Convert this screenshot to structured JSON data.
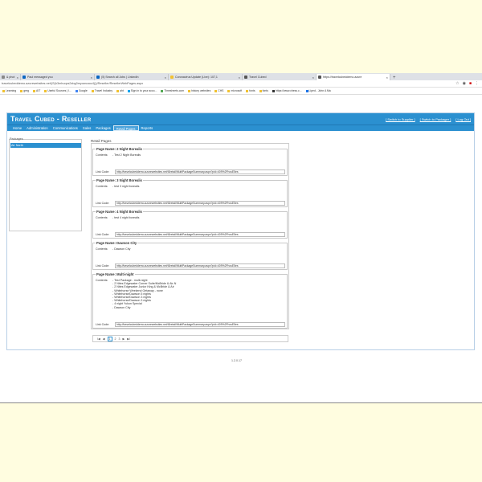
{
  "browser": {
    "tabs": [
      {
        "label": "& phot",
        "color": "#888888"
      },
      {
        "label": "Paul messaged you",
        "color": "#0a66c2"
      },
      {
        "label": "(5) Search all Jobs | LinkedIn",
        "color": "#0a66c2"
      },
      {
        "label": "Coronavirus Update (Live): 107,1",
        "color": "#f1c232"
      },
      {
        "label": "Travel Cubed",
        "color": "#555555"
      },
      {
        "label": "https://travelcubeddemo.azure",
        "color": "#555555"
      }
    ],
    "new_tab": "+",
    "url": "travelcubeddemo.azurewebsites.net/(S(h3mhuqvs2zbg0myowcaoc4)))/Reseller/ResellerWebPages.aspx",
    "bookmarks": [
      "Learning",
      "greg",
      "AIT",
      "Useful Sources | I...",
      "Google",
      "Travel Industry",
      "aht",
      "Sign in to your acco...",
      "Timesheets.com",
      "history websites",
      "CHS",
      "microsoft",
      "fonts",
      "fonts",
      "https://www.chess.c...",
      "Liped - John A Ma"
    ]
  },
  "app": {
    "brand": "Travel Cubed - Reseller",
    "top_links": [
      "[ Switch to Supplier ]",
      "[ Switch to Packager ]",
      "[ Log Out ]"
    ],
    "nav": [
      "Home",
      "Administration",
      "Communications",
      "Sales",
      "Packages",
      "Retail Pages",
      "Reports"
    ],
    "active_nav": "Retail Pages",
    "packages_label": "Packages",
    "package_selected": "Air North",
    "retail_title": "Retail Pages",
    "contents_label": "Contents:",
    "link_label": "Link Code:",
    "cards": [
      {
        "name": "Page Name: 2 Night Borealis",
        "contents": "- Test 2 Night Borealis",
        "link": "http://travelcubeddemo.azurewebsites.net/t3retail/MultiPackageSummary.aspx?pid=409%2FhcsE5es"
      },
      {
        "name": "Page Name: 3 Night Borealis",
        "contents": "- test 3 night borealis",
        "link": "http://travelcubeddemo.azurewebsites.net/t3retail/MultiPackageSummary.aspx?pid=409%2FhcsE5es"
      },
      {
        "name": "Page Name: 4 Night Borealis",
        "contents": "- test 4 night borealis",
        "link": "http://travelcubeddemo.azurewebsites.net/t3retail/MultiPackageSummary.aspx?pid=409%2FhcsE5es"
      },
      {
        "name": "Page Name: Dawson City",
        "contents": "- Dawson City",
        "link": "http://travelcubeddemo.azurewebsites.net/t3retail/MultiPackageSummary.aspx?pid=409%2FhcsE5es"
      },
      {
        "name": "Page Name: Multi-night",
        "contents": "- Test Package - multi-night\n- 2 Nites Edgewater Corner Suite/McBride & Air-N\n- 2 Nites Edgewater Junior King & McBride & Air\n- Whitehorse Weekend Getaway - none\n- Whitehorse/Dawson 5 nights\n- Whitehorse/Dawson 3 nights\n- Whitehorse/Dawson 3 nights\n- 4 night Yukon Special\n- Dawson City",
        "link": "http://travelcubeddemo.azurewebsites.net/t3retail/MultiPackageSummary.aspx?pid=409%2FhcsE5es"
      }
    ],
    "pager": {
      "first": "I◀",
      "prev": "◀",
      "pages": [
        "1",
        "2",
        "3"
      ],
      "current": "1",
      "next": "▶",
      "last": "▶I"
    },
    "version": "1.2.0.17"
  }
}
